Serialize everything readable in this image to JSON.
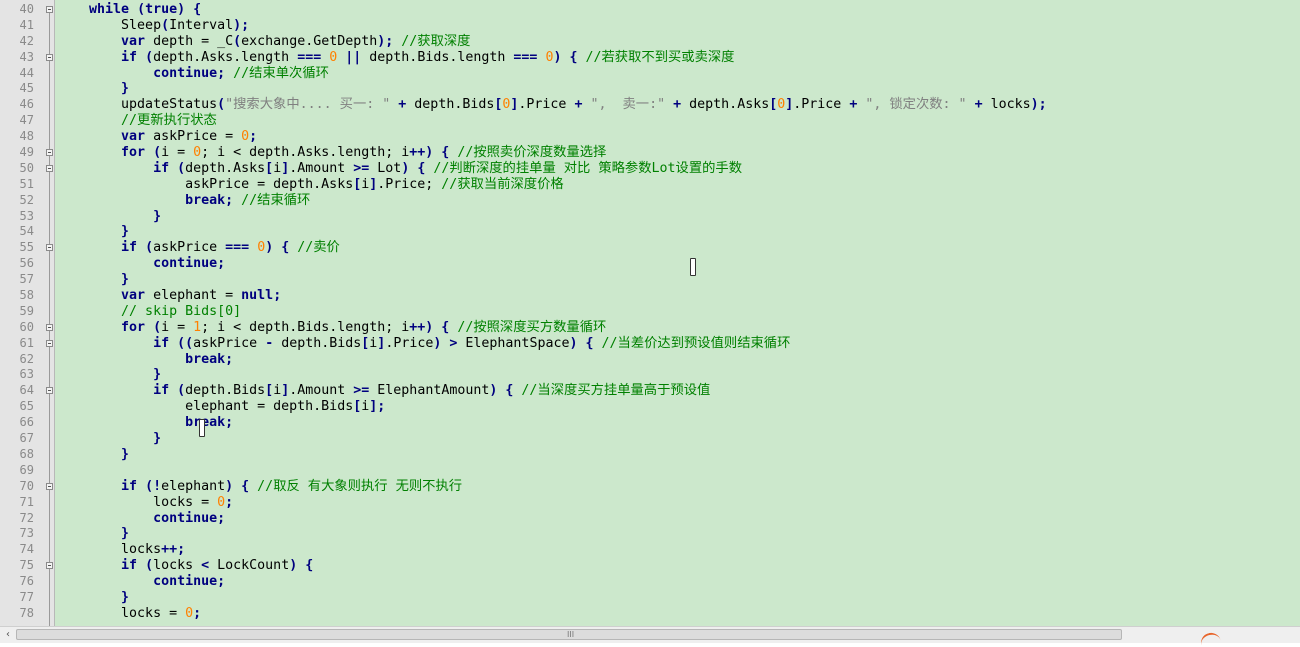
{
  "editor": {
    "lines": [
      {
        "n": "40",
        "fold": true,
        "tokens": [
          {
            "t": "    ",
            "c": "t"
          },
          {
            "t": "while",
            "c": "k"
          },
          {
            "t": " (",
            "c": "p"
          },
          {
            "t": "true",
            "c": "k"
          },
          {
            "t": ") {",
            "c": "p"
          }
        ]
      },
      {
        "n": "41",
        "fold": false,
        "tokens": [
          {
            "t": "        Sleep",
            "c": "t"
          },
          {
            "t": "(",
            "c": "p"
          },
          {
            "t": "Interval",
            "c": "t"
          },
          {
            "t": ");",
            "c": "p"
          }
        ]
      },
      {
        "n": "42",
        "fold": false,
        "tokens": [
          {
            "t": "        ",
            "c": "t"
          },
          {
            "t": "var",
            "c": "k"
          },
          {
            "t": " depth = _C",
            "c": "t"
          },
          {
            "t": "(",
            "c": "p"
          },
          {
            "t": "exchange.GetDepth",
            "c": "t"
          },
          {
            "t": ");",
            "c": "p"
          },
          {
            "t": " //获取深度",
            "c": "c"
          }
        ]
      },
      {
        "n": "43",
        "fold": true,
        "tokens": [
          {
            "t": "        ",
            "c": "t"
          },
          {
            "t": "if",
            "c": "k"
          },
          {
            "t": " (",
            "c": "p"
          },
          {
            "t": "depth.Asks.length ",
            "c": "t"
          },
          {
            "t": "===",
            "c": "p"
          },
          {
            "t": " ",
            "c": "t"
          },
          {
            "t": "0",
            "c": "n"
          },
          {
            "t": " || ",
            "c": "p"
          },
          {
            "t": "depth.Bids.length ",
            "c": "t"
          },
          {
            "t": "===",
            "c": "p"
          },
          {
            "t": " ",
            "c": "t"
          },
          {
            "t": "0",
            "c": "n"
          },
          {
            "t": ") {",
            "c": "p"
          },
          {
            "t": " //若获取不到买或卖深度",
            "c": "c"
          }
        ]
      },
      {
        "n": "44",
        "fold": false,
        "tokens": [
          {
            "t": "            ",
            "c": "t"
          },
          {
            "t": "continue",
            "c": "k"
          },
          {
            "t": ";",
            "c": "p"
          },
          {
            "t": " //结束单次循环",
            "c": "c"
          }
        ]
      },
      {
        "n": "45",
        "fold": false,
        "tokens": [
          {
            "t": "        ",
            "c": "t"
          },
          {
            "t": "}",
            "c": "p"
          }
        ]
      },
      {
        "n": "46",
        "fold": false,
        "tokens": [
          {
            "t": "        updateStatus",
            "c": "t"
          },
          {
            "t": "(",
            "c": "p"
          },
          {
            "t": "\"搜索大象中.... 买一: \"",
            "c": "s"
          },
          {
            "t": " + ",
            "c": "p"
          },
          {
            "t": "depth.Bids",
            "c": "t"
          },
          {
            "t": "[",
            "c": "p"
          },
          {
            "t": "0",
            "c": "n"
          },
          {
            "t": "]",
            "c": "p"
          },
          {
            "t": ".Price ",
            "c": "t"
          },
          {
            "t": "+",
            "c": "p"
          },
          {
            "t": " ",
            "c": "t"
          },
          {
            "t": "\",  卖一:\"",
            "c": "s"
          },
          {
            "t": " + ",
            "c": "p"
          },
          {
            "t": "depth.Asks",
            "c": "t"
          },
          {
            "t": "[",
            "c": "p"
          },
          {
            "t": "0",
            "c": "n"
          },
          {
            "t": "]",
            "c": "p"
          },
          {
            "t": ".Price ",
            "c": "t"
          },
          {
            "t": "+",
            "c": "p"
          },
          {
            "t": " ",
            "c": "t"
          },
          {
            "t": "\", 锁定次数: \"",
            "c": "s"
          },
          {
            "t": " + ",
            "c": "p"
          },
          {
            "t": "locks",
            "c": "t"
          },
          {
            "t": ");",
            "c": "p"
          }
        ]
      },
      {
        "n": "47",
        "fold": false,
        "tokens": [
          {
            "t": "        //更新执行状态",
            "c": "c"
          }
        ]
      },
      {
        "n": "48",
        "fold": false,
        "tokens": [
          {
            "t": "        ",
            "c": "t"
          },
          {
            "t": "var",
            "c": "k"
          },
          {
            "t": " askPrice = ",
            "c": "t"
          },
          {
            "t": "0",
            "c": "n"
          },
          {
            "t": ";",
            "c": "p"
          }
        ]
      },
      {
        "n": "49",
        "fold": true,
        "tokens": [
          {
            "t": "        ",
            "c": "t"
          },
          {
            "t": "for",
            "c": "k"
          },
          {
            "t": " (",
            "c": "p"
          },
          {
            "t": "i = ",
            "c": "t"
          },
          {
            "t": "0",
            "c": "n"
          },
          {
            "t": "; i < depth.Asks.length; i",
            "c": "t"
          },
          {
            "t": "++) {",
            "c": "p"
          },
          {
            "t": " //按照卖价深度数量选择",
            "c": "c"
          }
        ]
      },
      {
        "n": "50",
        "fold": true,
        "tokens": [
          {
            "t": "            ",
            "c": "t"
          },
          {
            "t": "if",
            "c": "k"
          },
          {
            "t": " (",
            "c": "p"
          },
          {
            "t": "depth.Asks",
            "c": "t"
          },
          {
            "t": "[",
            "c": "p"
          },
          {
            "t": "i",
            "c": "t"
          },
          {
            "t": "]",
            "c": "p"
          },
          {
            "t": ".Amount ",
            "c": "t"
          },
          {
            "t": ">=",
            "c": "p"
          },
          {
            "t": " Lot",
            "c": "t"
          },
          {
            "t": ") {",
            "c": "p"
          },
          {
            "t": " //判断深度的挂单量 对比 策略参数Lot设置的手数",
            "c": "c"
          }
        ]
      },
      {
        "n": "51",
        "fold": false,
        "tokens": [
          {
            "t": "                askPrice = depth.Asks",
            "c": "t"
          },
          {
            "t": "[",
            "c": "p"
          },
          {
            "t": "i",
            "c": "t"
          },
          {
            "t": "]",
            "c": "p"
          },
          {
            "t": ".Price;",
            "c": "t"
          },
          {
            "t": " //获取当前深度价格",
            "c": "c"
          }
        ]
      },
      {
        "n": "52",
        "fold": false,
        "tokens": [
          {
            "t": "                ",
            "c": "t"
          },
          {
            "t": "break",
            "c": "k"
          },
          {
            "t": ";",
            "c": "p"
          },
          {
            "t": " //结束循环",
            "c": "c"
          }
        ]
      },
      {
        "n": "53",
        "fold": false,
        "tokens": [
          {
            "t": "            ",
            "c": "t"
          },
          {
            "t": "}",
            "c": "p"
          }
        ]
      },
      {
        "n": "54",
        "fold": false,
        "tokens": [
          {
            "t": "        ",
            "c": "t"
          },
          {
            "t": "}",
            "c": "p"
          }
        ]
      },
      {
        "n": "55",
        "fold": true,
        "tokens": [
          {
            "t": "        ",
            "c": "t"
          },
          {
            "t": "if",
            "c": "k"
          },
          {
            "t": " (",
            "c": "p"
          },
          {
            "t": "askPrice ",
            "c": "t"
          },
          {
            "t": "===",
            "c": "p"
          },
          {
            "t": " ",
            "c": "t"
          },
          {
            "t": "0",
            "c": "n"
          },
          {
            "t": ") {",
            "c": "p"
          },
          {
            "t": " //卖价",
            "c": "c"
          }
        ]
      },
      {
        "n": "56",
        "fold": false,
        "tokens": [
          {
            "t": "            ",
            "c": "t"
          },
          {
            "t": "continue",
            "c": "k"
          },
          {
            "t": ";",
            "c": "p"
          }
        ]
      },
      {
        "n": "57",
        "fold": false,
        "tokens": [
          {
            "t": "        ",
            "c": "t"
          },
          {
            "t": "}",
            "c": "p"
          }
        ]
      },
      {
        "n": "58",
        "fold": false,
        "tokens": [
          {
            "t": "        ",
            "c": "t"
          },
          {
            "t": "var",
            "c": "k"
          },
          {
            "t": " elephant = ",
            "c": "t"
          },
          {
            "t": "null",
            "c": "k"
          },
          {
            "t": ";",
            "c": "p"
          }
        ]
      },
      {
        "n": "59",
        "fold": false,
        "tokens": [
          {
            "t": "        // skip Bids[0]",
            "c": "c"
          }
        ]
      },
      {
        "n": "60",
        "fold": true,
        "tokens": [
          {
            "t": "        ",
            "c": "t"
          },
          {
            "t": "for",
            "c": "k"
          },
          {
            "t": " (",
            "c": "p"
          },
          {
            "t": "i = ",
            "c": "t"
          },
          {
            "t": "1",
            "c": "n"
          },
          {
            "t": "; i < depth.Bids.length; i",
            "c": "t"
          },
          {
            "t": "++) {",
            "c": "p"
          },
          {
            "t": " //按照深度买方数量循环",
            "c": "c"
          }
        ]
      },
      {
        "n": "61",
        "fold": true,
        "tokens": [
          {
            "t": "            ",
            "c": "t"
          },
          {
            "t": "if",
            "c": "k"
          },
          {
            "t": " ((",
            "c": "p"
          },
          {
            "t": "askPrice ",
            "c": "t"
          },
          {
            "t": "-",
            "c": "p"
          },
          {
            "t": " depth.Bids",
            "c": "t"
          },
          {
            "t": "[",
            "c": "p"
          },
          {
            "t": "i",
            "c": "t"
          },
          {
            "t": "]",
            "c": "p"
          },
          {
            "t": ".Price",
            "c": "t"
          },
          {
            "t": ") >",
            "c": "p"
          },
          {
            "t": " ElephantSpace",
            "c": "t"
          },
          {
            "t": ") {",
            "c": "p"
          },
          {
            "t": " //当差价达到预设值则结束循环",
            "c": "c"
          }
        ]
      },
      {
        "n": "62",
        "fold": false,
        "tokens": [
          {
            "t": "                ",
            "c": "t"
          },
          {
            "t": "break",
            "c": "k"
          },
          {
            "t": ";",
            "c": "p"
          }
        ]
      },
      {
        "n": "63",
        "fold": false,
        "tokens": [
          {
            "t": "            ",
            "c": "t"
          },
          {
            "t": "}",
            "c": "p"
          }
        ]
      },
      {
        "n": "64",
        "fold": true,
        "tokens": [
          {
            "t": "            ",
            "c": "t"
          },
          {
            "t": "if",
            "c": "k"
          },
          {
            "t": " (",
            "c": "p"
          },
          {
            "t": "depth.Bids",
            "c": "t"
          },
          {
            "t": "[",
            "c": "p"
          },
          {
            "t": "i",
            "c": "t"
          },
          {
            "t": "]",
            "c": "p"
          },
          {
            "t": ".Amount ",
            "c": "t"
          },
          {
            "t": ">=",
            "c": "p"
          },
          {
            "t": " ElephantAmount",
            "c": "t"
          },
          {
            "t": ") {",
            "c": "p"
          },
          {
            "t": " //当深度买方挂单量高于预设值",
            "c": "c"
          }
        ]
      },
      {
        "n": "65",
        "fold": false,
        "tokens": [
          {
            "t": "                elephant = depth.Bids",
            "c": "t"
          },
          {
            "t": "[",
            "c": "p"
          },
          {
            "t": "i",
            "c": "t"
          },
          {
            "t": "];",
            "c": "p"
          }
        ]
      },
      {
        "n": "66",
        "fold": false,
        "tokens": [
          {
            "t": "                ",
            "c": "t"
          },
          {
            "t": "break",
            "c": "k"
          },
          {
            "t": ";",
            "c": "p"
          }
        ]
      },
      {
        "n": "67",
        "fold": false,
        "tokens": [
          {
            "t": "            ",
            "c": "t"
          },
          {
            "t": "}",
            "c": "p"
          }
        ]
      },
      {
        "n": "68",
        "fold": false,
        "tokens": [
          {
            "t": "        ",
            "c": "t"
          },
          {
            "t": "}",
            "c": "p"
          }
        ]
      },
      {
        "n": "69",
        "fold": false,
        "tokens": []
      },
      {
        "n": "70",
        "fold": true,
        "tokens": [
          {
            "t": "        ",
            "c": "t"
          },
          {
            "t": "if",
            "c": "k"
          },
          {
            "t": " (!",
            "c": "p"
          },
          {
            "t": "elephant",
            "c": "t"
          },
          {
            "t": ") {",
            "c": "p"
          },
          {
            "t": " //取反 有大象则执行 无则不执行",
            "c": "c"
          }
        ]
      },
      {
        "n": "71",
        "fold": false,
        "tokens": [
          {
            "t": "            locks = ",
            "c": "t"
          },
          {
            "t": "0",
            "c": "n"
          },
          {
            "t": ";",
            "c": "p"
          }
        ]
      },
      {
        "n": "72",
        "fold": false,
        "tokens": [
          {
            "t": "            ",
            "c": "t"
          },
          {
            "t": "continue",
            "c": "k"
          },
          {
            "t": ";",
            "c": "p"
          }
        ]
      },
      {
        "n": "73",
        "fold": false,
        "tokens": [
          {
            "t": "        ",
            "c": "t"
          },
          {
            "t": "}",
            "c": "p"
          }
        ]
      },
      {
        "n": "74",
        "fold": false,
        "tokens": [
          {
            "t": "        locks",
            "c": "t"
          },
          {
            "t": "++;",
            "c": "p"
          }
        ]
      },
      {
        "n": "75",
        "fold": true,
        "tokens": [
          {
            "t": "        ",
            "c": "t"
          },
          {
            "t": "if",
            "c": "k"
          },
          {
            "t": " (",
            "c": "p"
          },
          {
            "t": "locks ",
            "c": "t"
          },
          {
            "t": "<",
            "c": "p"
          },
          {
            "t": " LockCount",
            "c": "t"
          },
          {
            "t": ") {",
            "c": "p"
          }
        ]
      },
      {
        "n": "76",
        "fold": false,
        "tokens": [
          {
            "t": "            ",
            "c": "t"
          },
          {
            "t": "continue",
            "c": "k"
          },
          {
            "t": ";",
            "c": "p"
          }
        ]
      },
      {
        "n": "77",
        "fold": false,
        "tokens": [
          {
            "t": "        ",
            "c": "t"
          },
          {
            "t": "}",
            "c": "p"
          }
        ]
      },
      {
        "n": "78",
        "fold": false,
        "tokens": [
          {
            "t": "        locks = ",
            "c": "t"
          },
          {
            "t": "0",
            "c": "n"
          },
          {
            "t": ";",
            "c": "p"
          }
        ]
      }
    ]
  },
  "scrollbar": {
    "left_arrow": "‹",
    "grip": "III"
  },
  "colors": {
    "background": "#cce8cc",
    "keyword": "#00007f",
    "comment": "#008000",
    "string": "#808080",
    "number": "#ff8000"
  }
}
